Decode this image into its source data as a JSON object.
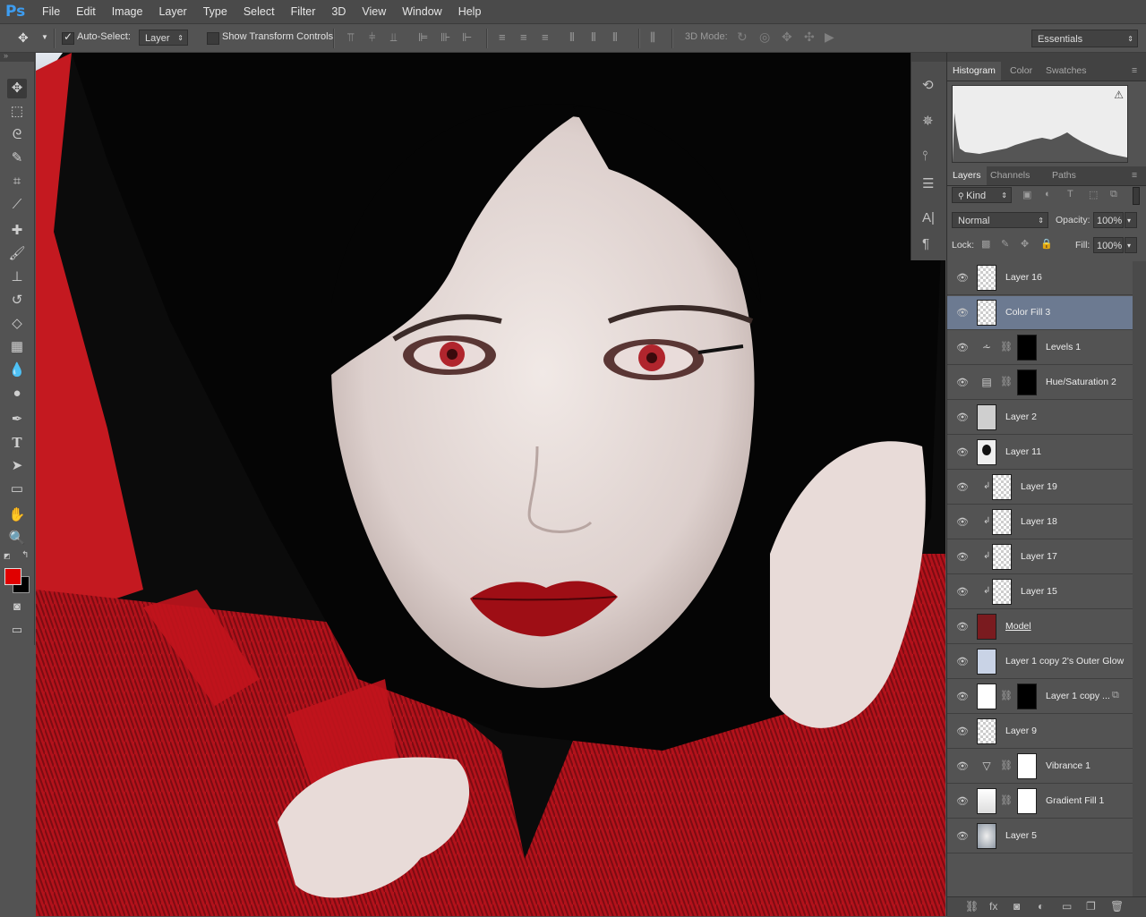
{
  "app": {
    "logo": "Ps"
  },
  "menu": [
    "File",
    "Edit",
    "Image",
    "Layer",
    "Type",
    "Select",
    "Filter",
    "3D",
    "View",
    "Window",
    "Help"
  ],
  "options": {
    "auto_select_label": "Auto-Select:",
    "auto_select_value": "Layer",
    "show_transform_label": "Show Transform Controls",
    "mode_3d_label": "3D Mode:",
    "workspace": "Essentials"
  },
  "colors": {
    "foreground": "#e00000",
    "background": "#000000",
    "selected_layer": "#6c7a91"
  },
  "top_panel": {
    "tabs": [
      "Histogram",
      "Color",
      "Swatches"
    ],
    "active_tab": "Histogram",
    "warning_icon": "warning-icon"
  },
  "layers_panel": {
    "tabs": [
      "Layers",
      "Channels",
      "Paths"
    ],
    "filter_kind": "Kind",
    "blend_mode": "Normal",
    "opacity_label": "Opacity:",
    "opacity_value": "100%",
    "lock_label": "Lock:",
    "fill_label": "Fill:",
    "fill_value": "100%",
    "layers": [
      {
        "name": "Layer 16",
        "kind": "pixel",
        "selected": false,
        "clipped": false,
        "mask": false
      },
      {
        "name": "Color Fill 3",
        "kind": "pixel",
        "selected": true,
        "clipped": false,
        "mask": false
      },
      {
        "name": "Levels 1",
        "kind": "levels",
        "selected": false,
        "clipped": false,
        "mask": "black"
      },
      {
        "name": "Hue/Saturation 2",
        "kind": "hue",
        "selected": false,
        "clipped": false,
        "mask": "black"
      },
      {
        "name": "Layer 2",
        "kind": "gray",
        "selected": false,
        "clipped": false,
        "mask": false
      },
      {
        "name": "Layer 11",
        "kind": "hair",
        "selected": false,
        "clipped": false,
        "mask": false
      },
      {
        "name": "Layer 19",
        "kind": "pixel",
        "selected": false,
        "clipped": true,
        "mask": false
      },
      {
        "name": "Layer 18",
        "kind": "pixel",
        "selected": false,
        "clipped": true,
        "mask": false
      },
      {
        "name": "Layer 17",
        "kind": "pixel",
        "selected": false,
        "clipped": true,
        "mask": false
      },
      {
        "name": "Layer 15",
        "kind": "pixel",
        "selected": false,
        "clipped": true,
        "mask": false
      },
      {
        "name": "Model",
        "kind": "model",
        "selected": false,
        "clipped": false,
        "mask": false,
        "underline": true
      },
      {
        "name": "Layer 1 copy 2's Outer Glow",
        "kind": "glow",
        "selected": false,
        "clipped": false,
        "mask": false
      },
      {
        "name": "Layer 1 copy ...",
        "kind": "white",
        "selected": false,
        "clipped": false,
        "mask": "silhouette",
        "smart": true
      },
      {
        "name": "Layer 9",
        "kind": "pixel",
        "selected": false,
        "clipped": false,
        "mask": false
      },
      {
        "name": "Vibrance 1",
        "kind": "vibrance",
        "selected": false,
        "clipped": false,
        "mask": "white"
      },
      {
        "name": "Gradient Fill 1",
        "kind": "gradient",
        "selected": false,
        "clipped": false,
        "mask": "white"
      },
      {
        "name": "Layer 5",
        "kind": "bg",
        "selected": false,
        "clipped": false,
        "mask": false
      }
    ],
    "footer_icons": [
      "link-icon",
      "fx-icon",
      "mask-icon",
      "adjustment-icon",
      "folder-icon",
      "new-layer-icon",
      "trash-icon"
    ]
  }
}
